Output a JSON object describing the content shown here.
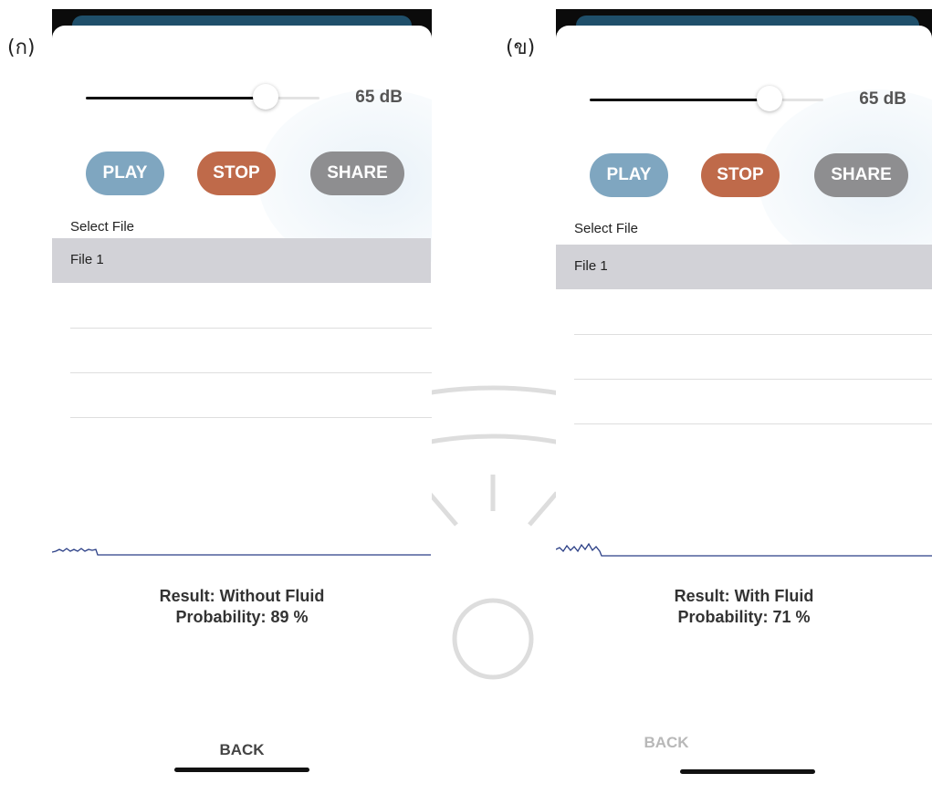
{
  "colors": {
    "play": "#7fa6c0",
    "stop": "#bf6a4a",
    "share": "#8e8e90",
    "file_row": "#d2d2d7",
    "waveform": "#2b3f86"
  },
  "panels": [
    {
      "label": "(ก)",
      "volume": {
        "value": 65,
        "label": "65 dB",
        "fraction": 0.77
      },
      "buttons": {
        "play": "PLAY",
        "stop": "STOP",
        "share": "SHARE"
      },
      "select_label": "Select File",
      "files": [
        "File 1"
      ],
      "result": {
        "line1": "Result: Without Fluid",
        "line2": "Probability: 89 %"
      },
      "back": "BACK"
    },
    {
      "label": "(ข)",
      "volume": {
        "value": 65,
        "label": "65 dB",
        "fraction": 0.77
      },
      "buttons": {
        "play": "PLAY",
        "stop": "STOP",
        "share": "SHARE"
      },
      "select_label": "Select File",
      "files": [
        "File 1"
      ],
      "result": {
        "line1": "Result: With Fluid",
        "line2": "Probability: 71 %"
      },
      "back": "BACK"
    }
  ]
}
